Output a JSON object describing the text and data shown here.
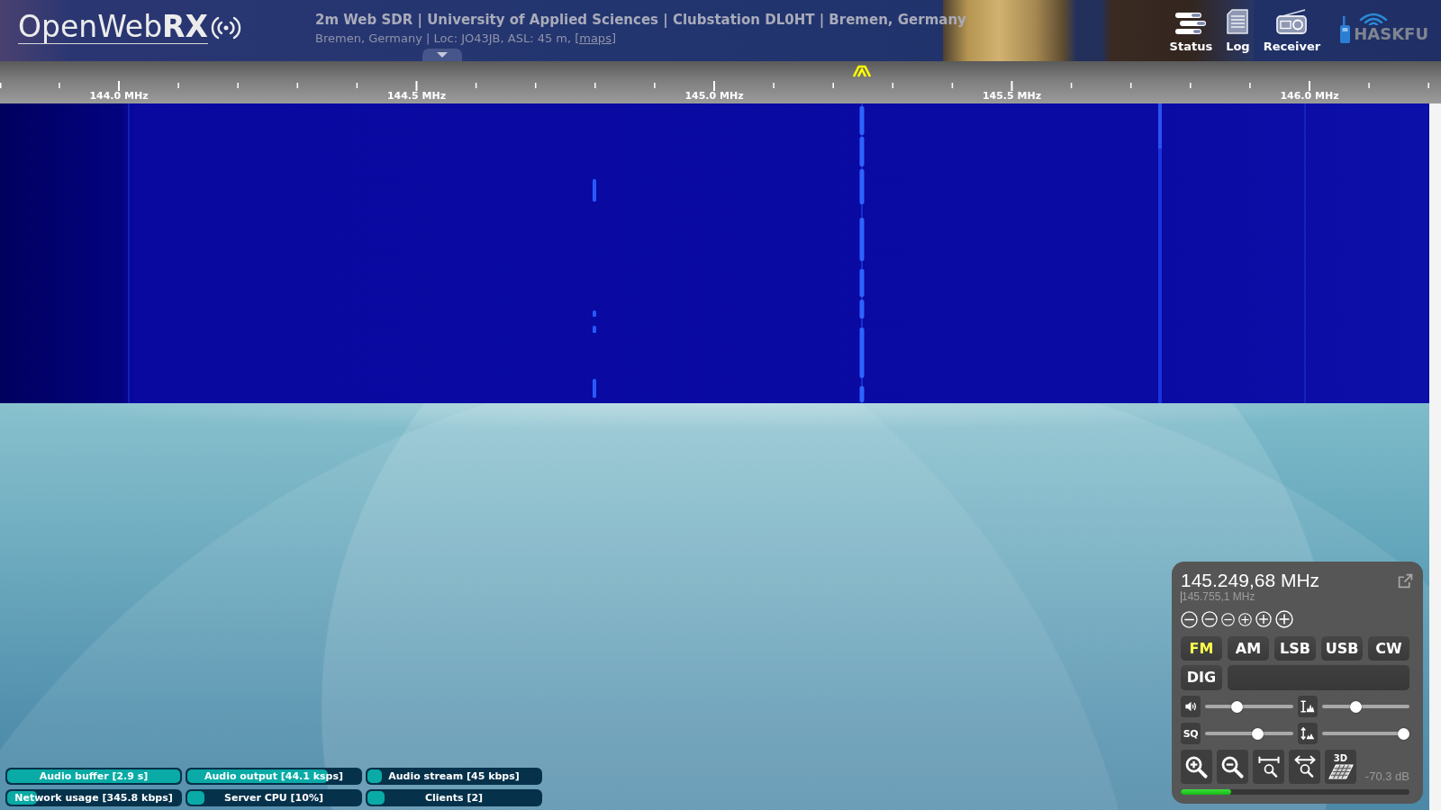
{
  "header": {
    "logo": "OpenWeb**RX**",
    "title": "2m Web SDR | University of Applied Sciences | Clubstation DL0HT | Bremen, Germany",
    "subtitle": "Bremen, Germany | Loc: JO43JB, ASL: 45 m,",
    "maps_link": "[maps]",
    "buttons": [
      {
        "kind": "status",
        "label": "Status"
      },
      {
        "kind": "log",
        "label": "Log"
      },
      {
        "kind": "receiver",
        "label": "Receiver"
      }
    ],
    "sponsor_logo": "HASKFU"
  },
  "frequency_scale": {
    "labels": [
      "144.0 MHz",
      "144.5 MHz",
      "145.0 MHz",
      "145.5 MHz",
      "146.0 MHz"
    ]
  },
  "receiver_panel": {
    "frequency": "145.249,68 MHz",
    "mouse_frequency": "145.755,1 MHz",
    "step_buttons": [
      {
        "kind": "minus"
      },
      {
        "kind": "minus"
      },
      {
        "kind": "minus"
      },
      {
        "kind": "plus"
      },
      {
        "kind": "plus"
      },
      {
        "kind": "plus"
      }
    ],
    "modes": [
      {
        "label": "FM",
        "selected": true
      },
      {
        "label": "AM",
        "selected": false
      },
      {
        "label": "LSB",
        "selected": false
      },
      {
        "label": "USB",
        "selected": false
      },
      {
        "label": "CW",
        "selected": false
      },
      {
        "label": "DIG",
        "selected": false
      }
    ],
    "sliders": [
      {
        "kind": "volume",
        "level": 0.34
      },
      {
        "kind": "range",
        "level": 0.37
      },
      {
        "kind": "squelch",
        "label": "SQ",
        "level": 0.62
      },
      {
        "kind": "auto",
        "level": 1.0
      }
    ],
    "zoom_buttons": [
      {
        "kind": "zoom_in"
      },
      {
        "kind": "zoom_out"
      },
      {
        "kind": "zoom_band"
      },
      {
        "kind": "zoom_fit"
      },
      {
        "kind": "view_3d",
        "label": "3D"
      }
    ],
    "s_meter": {
      "reading": "-70.3 dB",
      "level": 0.22
    }
  },
  "status_bars": [
    {
      "label": "Audio buffer [2.9 s]",
      "level": 1.0
    },
    {
      "label": "Audio output [44.1 ksps]",
      "level": 0.81
    },
    {
      "label": "Audio stream [45 kbps]",
      "level": 0.08
    },
    {
      "label": "Network usage [345.8 kbps]",
      "level": 0.17
    },
    {
      "label": "Server CPU [10%]",
      "level": 0.1
    },
    {
      "label": "Clients [2]",
      "level": 0.1
    }
  ]
}
